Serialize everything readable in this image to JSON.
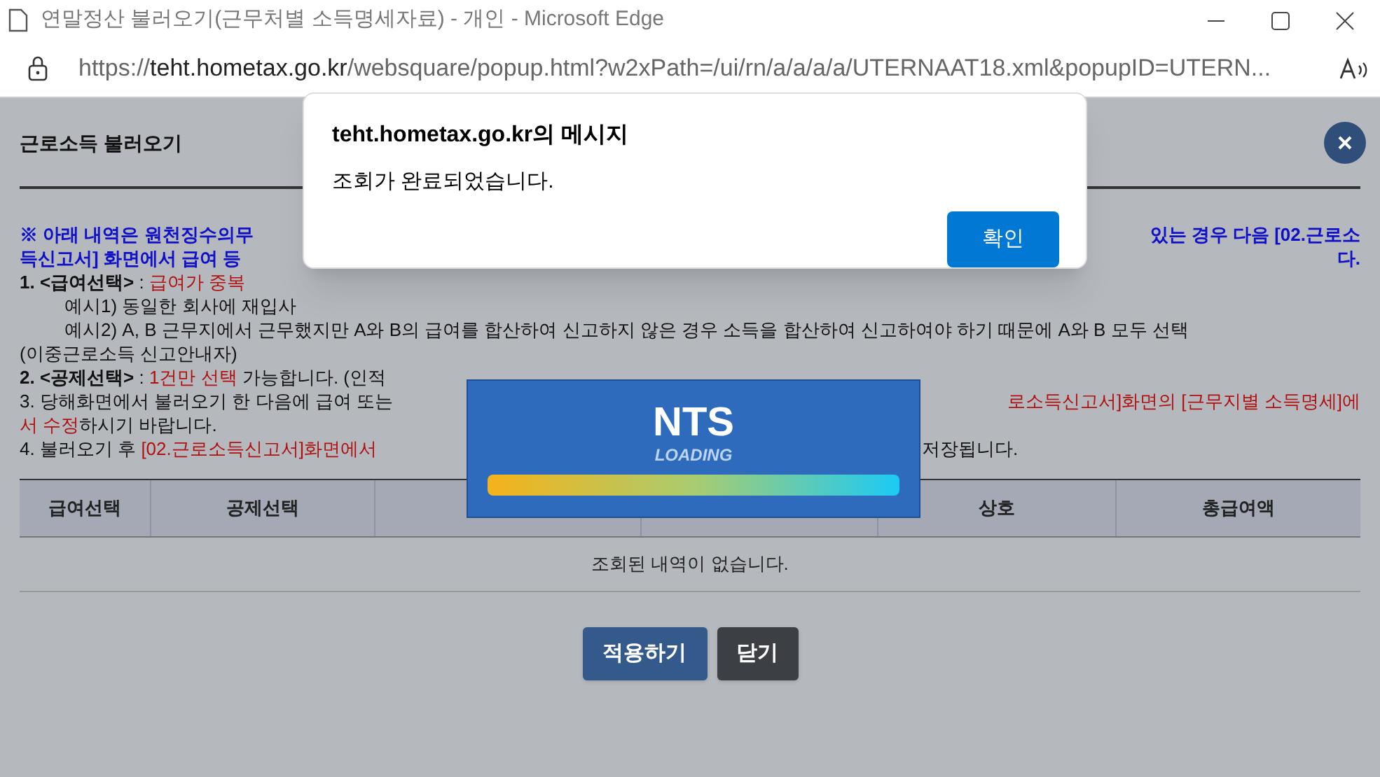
{
  "browser": {
    "title": "연말정산 불러오기(근무처별 소득명세자료) - 개인 - Microsoft Edge",
    "url_host": "https://teht.hometax.go.kr",
    "url_path": "/websquare/popup.html?w2xPath=/ui/rn/a/a/a/a/UTERNAAT18.xml&popupID=UTERN..."
  },
  "page": {
    "title": "근로소득 불러오기",
    "notice_lines": [
      {
        "kind": "plain",
        "left": [
          {
            "text": "**※ 아래 내역은 원천징수의무**",
            "color": "#1010c8"
          }
        ],
        "right": [
          {
            "text": "**있는 경우 다음 [02.근로소**",
            "color": "#1010c8"
          }
        ]
      },
      {
        "kind": "plain",
        "left": [
          {
            "text": "**득신고서] 화면에서 급여 등**",
            "color": "#1010c8"
          }
        ],
        "right": [
          {
            "text": "**다.**",
            "color": "#1010c8"
          }
        ]
      },
      {
        "kind": "plain",
        "left": [
          {
            "text": "**1. <급여선택>** : ",
            "color": "#111111"
          },
          {
            "text": "급여가 중복",
            "color": "#b01010"
          }
        ]
      },
      {
        "kind": "indented",
        "left": [
          {
            "text": "예시1) 동일한 회사에 재입사",
            "color": "#111111"
          }
        ]
      },
      {
        "kind": "indented",
        "left": [
          {
            "text": "예시2) A, B 근무지에서 근무했지만 A와 B의 급여를 합산하여 신고하지 않은 경우 소득을 합산하여 신고하여야 하기 때문에 A와 B 모두 선택",
            "color": "#111111"
          }
        ]
      },
      {
        "kind": "plain",
        "left": [
          {
            "text": "(이중근로소득 신고안내자)",
            "color": "#111111"
          }
        ]
      },
      {
        "kind": "plain",
        "left": [
          {
            "text": "**2. <공제선택>** : ",
            "color": "#111111"
          },
          {
            "text": "1건만 선택",
            "color": "#b01010"
          },
          {
            "text": " 가능합니다. (인적",
            "color": "#111111"
          }
        ]
      },
      {
        "kind": "plain",
        "left": [
          {
            "text": "3. 당해화면에서 불러오기 한 다음에 급여 또는",
            "color": "#111111"
          }
        ],
        "right": [
          {
            "text": "로소득신고서]화면의 [근무지별 소득명세]에",
            "color": "#b01010"
          }
        ]
      },
      {
        "kind": "plain",
        "left": [
          {
            "text": "서 수정",
            "color": "#b01010"
          },
          {
            "text": "하시기 바랍니다.",
            "color": "#111111"
          }
        ]
      },
      {
        "kind": "plain",
        "left": [
          {
            "text": "4. 불러오기 후 ",
            "color": "#111111"
          },
          {
            "text": "[02.근로소득신고서]화면에서",
            "color": "#b01010"
          }
        ],
        "middle": [
          {
            "text": "저장됩니다.",
            "color": "#111111"
          }
        ]
      }
    ],
    "table": {
      "columns": [
        {
          "label": "급여선택"
        },
        {
          "label": "공제선택"
        },
        {},
        {},
        {
          "label": "상호"
        },
        {
          "label": "총급여액"
        }
      ],
      "empty_message": "조회된 내역이 없습니다."
    },
    "buttons": [
      {
        "label": "적용하기",
        "kind": "primary"
      },
      {
        "label": "닫기",
        "kind": "dark"
      }
    ]
  },
  "loading": {
    "logo": "NTS",
    "caption": "LOADING"
  },
  "dialog": {
    "title": "teht.hometax.go.kr의 메시지",
    "message": "조회가 완료되었습니다.",
    "ok": "확인"
  }
}
